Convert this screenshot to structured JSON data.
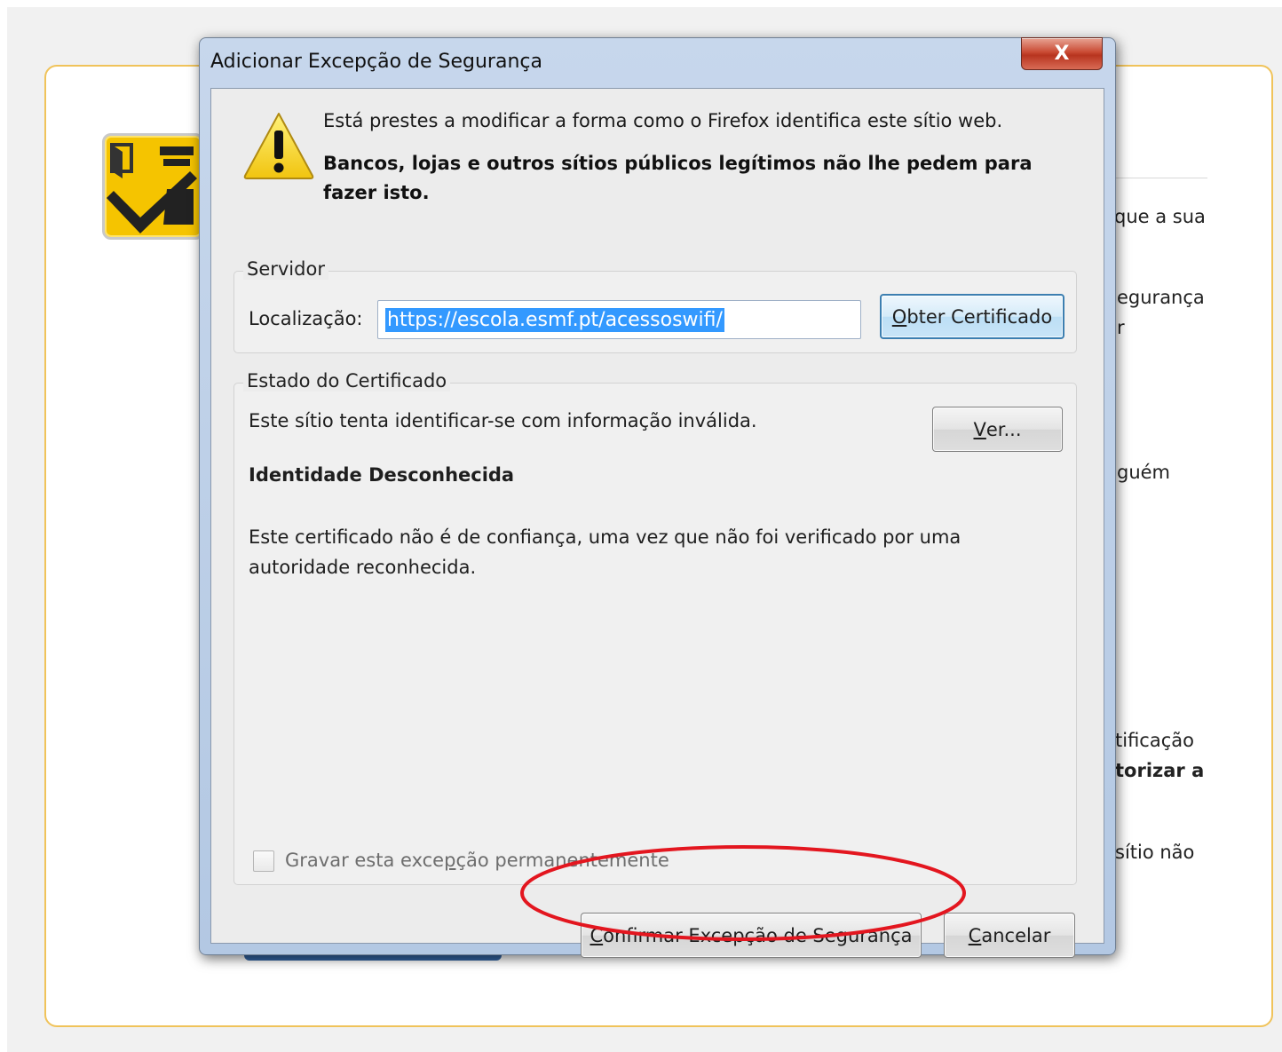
{
  "background_page": {
    "snippets": [
      {
        "id": "que-a-sua",
        "text": "que a sua"
      },
      {
        "id": "seguranca",
        "text": "egurança"
      },
      {
        "id": "r",
        "text": "r"
      },
      {
        "id": "guem",
        "text": "guém"
      },
      {
        "id": "tificacao",
        "text": "tificação"
      },
      {
        "id": "torizar-a",
        "text": "torizar a"
      },
      {
        "id": "sitio-nao",
        "text": "sítio não"
      }
    ]
  },
  "dialog": {
    "title": "Adicionar Excepção de Segurança",
    "close_label": "X",
    "warning_line1": "Está prestes a modificar a forma como o Firefox identifica este sítio web.",
    "warning_line2": "Bancos, lojas e outros sítios públicos legítimos não lhe pedem para fazer isto.",
    "server": {
      "legend": "Servidor",
      "location_label": "Localização:",
      "location_value": "https://escola.esmf.pt/acessoswifi/",
      "get_certificate": {
        "accel": "O",
        "rest": "bter Certificado"
      }
    },
    "certificate_status": {
      "legend": "Estado do Certificado",
      "status_text": "Este sítio tenta identificar-se com informação inválida.",
      "view_button": {
        "accel": "V",
        "rest": "er..."
      },
      "identity_heading": "Identidade Desconhecida",
      "identity_detail": "Este certificado não é de confiança, uma vez que não foi verificado por uma autoridade reconhecida."
    },
    "permanent_checkbox": {
      "before": "Gravar esta exce",
      "accel": "p",
      "after": "ção permanentemente",
      "checked": false
    },
    "confirm_button": {
      "accel": "C",
      "rest": "onfirmar Excepção de Segurança"
    },
    "cancel_button": {
      "accel": "C",
      "rest": "ancelar"
    }
  },
  "colors": {
    "highlight_ellipse": "#e3161f",
    "selection": "#3399ff",
    "warning_yellow": "#f7d51c",
    "box_border": "#f0c35a"
  }
}
